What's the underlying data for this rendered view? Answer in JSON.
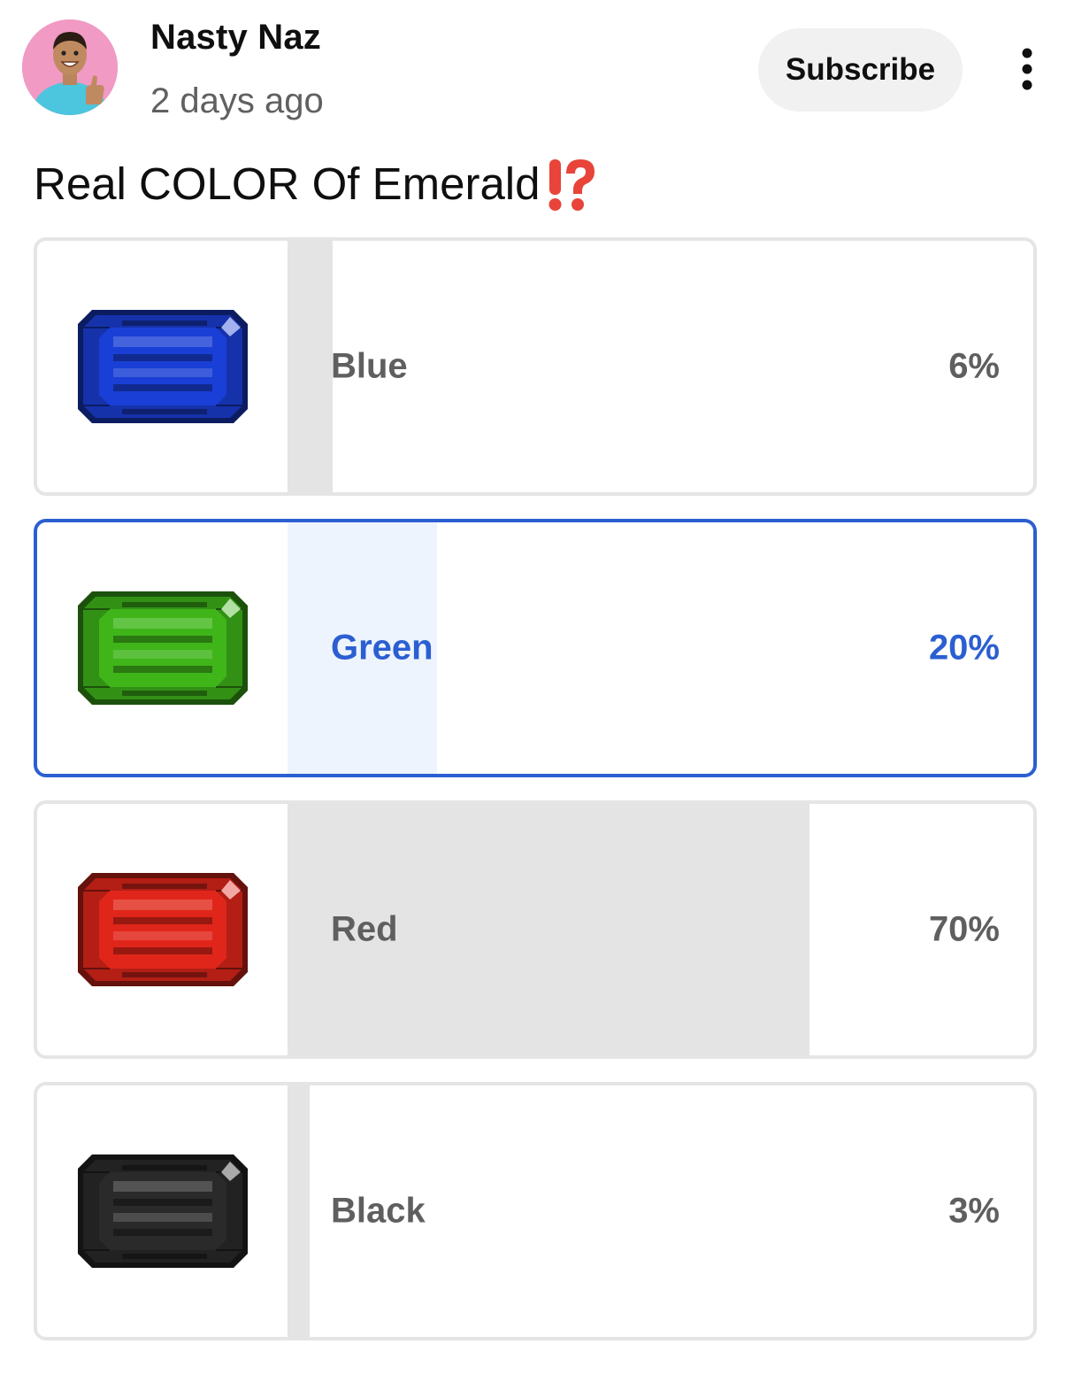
{
  "post": {
    "channel_name": "Nasty Naz",
    "timestamp": "2 days ago",
    "subscribe_label": "Subscribe",
    "more_icon": "more-vert-icon",
    "avatar_icon": "channel-avatar",
    "title": "Real COLOR Of Emerald",
    "title_emoji": "⁉️"
  },
  "poll": {
    "options": [
      {
        "label": "Blue",
        "percent_text": "6%",
        "percent": 6,
        "selected": false,
        "gem_color": "#1a3fd6",
        "icon": "blue-gem-icon"
      },
      {
        "label": "Green",
        "percent_text": "20%",
        "percent": 20,
        "selected": true,
        "gem_color": "#3fb51a",
        "icon": "green-gem-icon"
      },
      {
        "label": "Red",
        "percent_text": "70%",
        "percent": 70,
        "selected": false,
        "gem_color": "#e0261a",
        "icon": "red-gem-icon"
      },
      {
        "label": "Black",
        "percent_text": "3%",
        "percent": 3,
        "selected": false,
        "gem_color": "#2a2a2a",
        "icon": "black-gem-icon"
      }
    ]
  },
  "colors": {
    "selected_accent": "#2b5fd1",
    "bar_fill": "#e4e4e4",
    "selected_bar_fill": "#eef4fd",
    "subscribe_bg": "#f1f1f1"
  }
}
